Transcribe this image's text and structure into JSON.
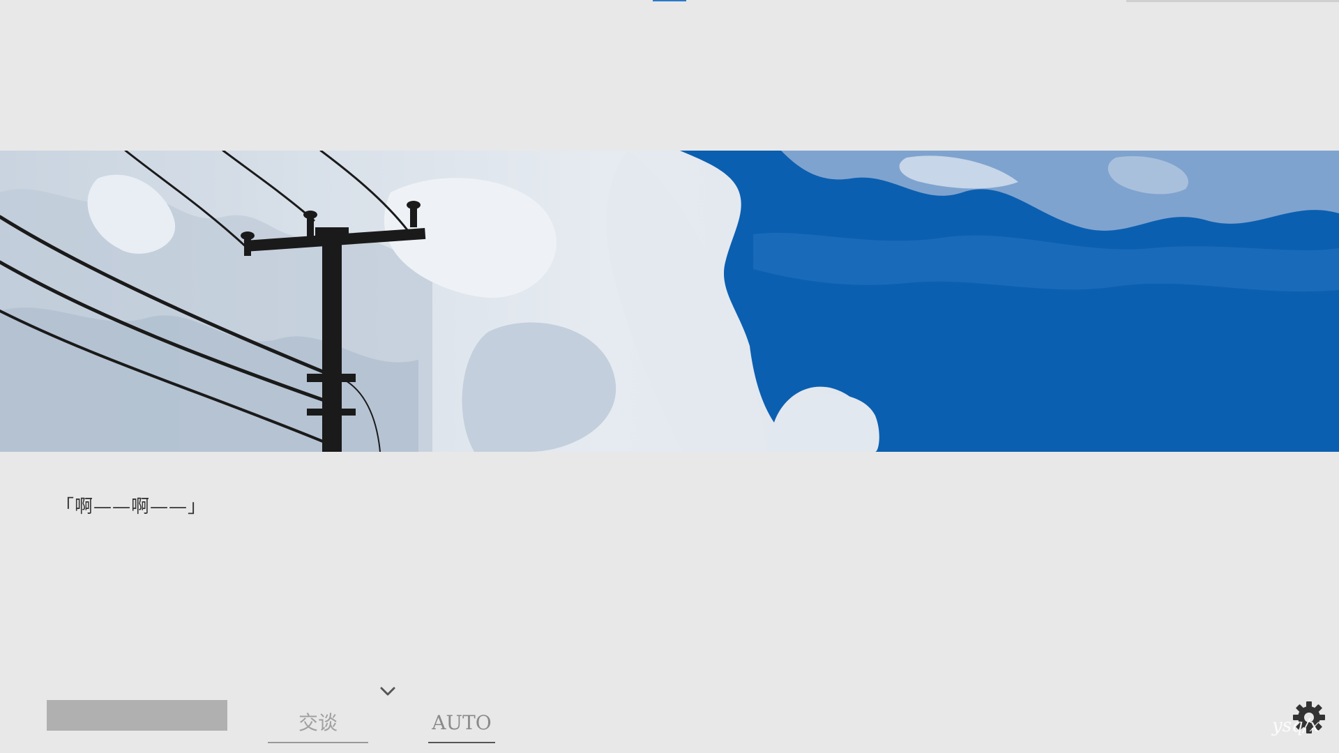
{
  "dialogue": {
    "text": "「啊——啊——」"
  },
  "controls": {
    "mode_talk_label": "交谈",
    "mode_auto_label": "AUTO",
    "chevron_icon": "chevron-down-icon",
    "settings_icon": "gear-icon"
  },
  "banner": {
    "sky_color": "#0b5fb0",
    "cloud_color": "#dde4ec",
    "pole_color": "#1a1a1a"
  },
  "watermark": {
    "text": "ysq/x"
  }
}
